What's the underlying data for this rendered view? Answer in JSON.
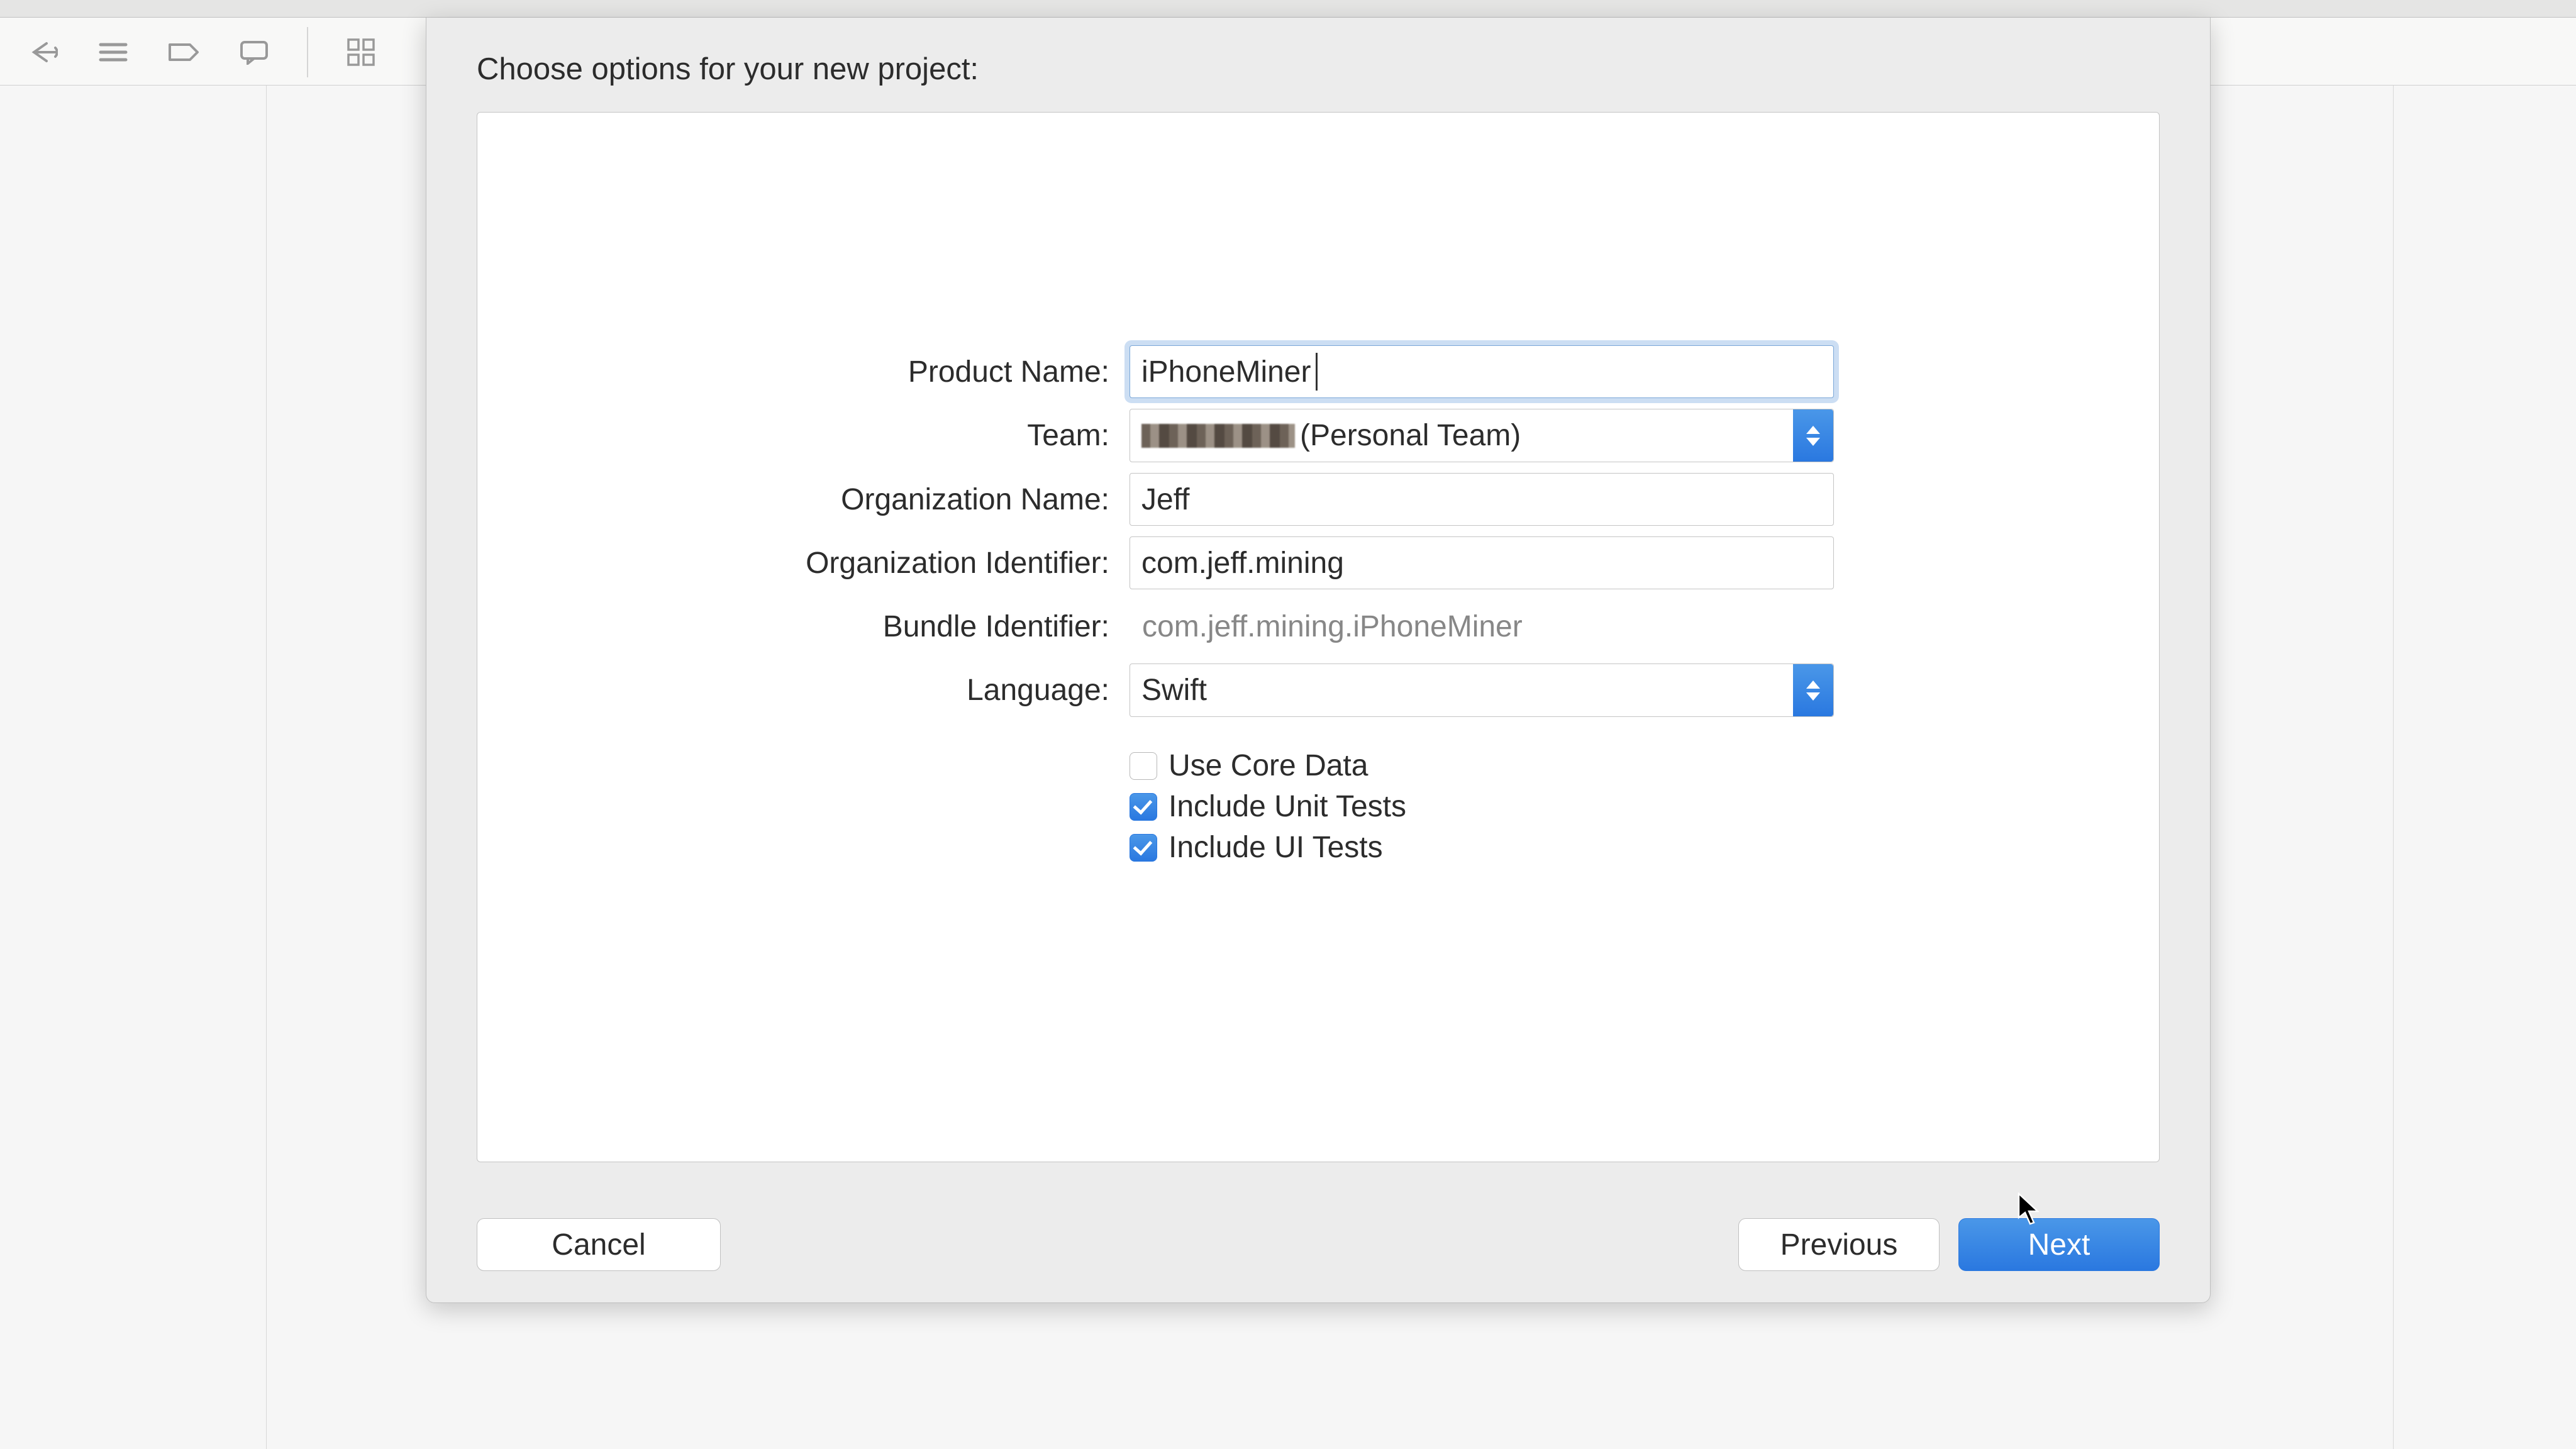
{
  "dialog": {
    "title": "Choose options for your new project:",
    "fields": {
      "product_name": {
        "label": "Product Name:",
        "value": "iPhoneMiner"
      },
      "team": {
        "label": "Team:",
        "value_suffix": "(Personal Team)"
      },
      "org_name": {
        "label": "Organization Name:",
        "value": "Jeff"
      },
      "org_identifier": {
        "label": "Organization Identifier:",
        "value": "com.jeff.mining"
      },
      "bundle_identifier": {
        "label": "Bundle Identifier:",
        "value": "com.jeff.mining.iPhoneMiner"
      },
      "language": {
        "label": "Language:",
        "value": "Swift"
      }
    },
    "checkboxes": {
      "core_data": {
        "label": "Use Core Data",
        "checked": false
      },
      "unit_tests": {
        "label": "Include Unit Tests",
        "checked": true
      },
      "ui_tests": {
        "label": "Include UI Tests",
        "checked": true
      }
    },
    "buttons": {
      "cancel": "Cancel",
      "previous": "Previous",
      "next": "Next"
    }
  }
}
